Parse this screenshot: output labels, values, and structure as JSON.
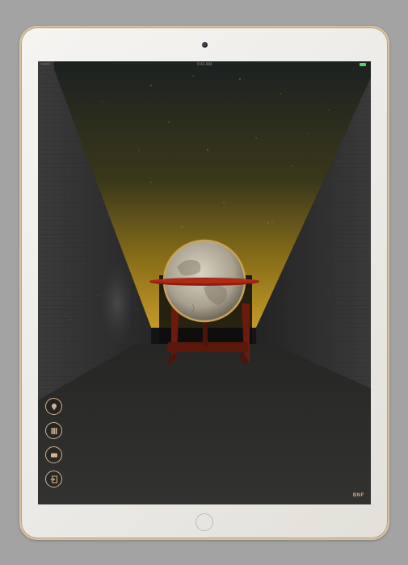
{
  "status_bar": {
    "carrier": "••••• ",
    "time": "9:41 AM",
    "battery_label": "100%"
  },
  "toolbar": {
    "buttons": [
      {
        "name": "light",
        "icon": "lightbulb-icon"
      },
      {
        "name": "books",
        "icon": "books-icon"
      },
      {
        "name": "screen",
        "icon": "screen-icon"
      },
      {
        "name": "exit",
        "icon": "exit-icon"
      }
    ]
  },
  "branding": {
    "logo_text": "BNF"
  },
  "colors": {
    "accent": "#d7b48a",
    "sky_top": "#1f2224",
    "sky_glow": "#9a7d1e",
    "wall": "#3a3a3a",
    "floor": "#2d2d2b",
    "globe_stand": "#6b1a0d"
  }
}
